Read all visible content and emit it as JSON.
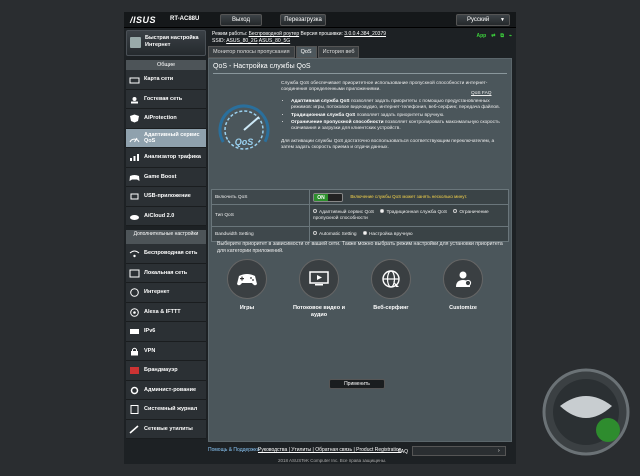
{
  "header": {
    "logo": "/ISUS",
    "model": "RT-AC88U",
    "logout": "Выход",
    "reboot": "Перезагрузка",
    "language": "Русский"
  },
  "info": {
    "mode_label": "Режим работы:",
    "mode_value": "Беспроводной роутер",
    "fw_label": "Версия прошивки:",
    "fw_value": "3.0.0.4.384_20379",
    "ssid_label": "SSID:",
    "ssid1": "ASUS_80_2G",
    "ssid2": "ASUS_80_5G",
    "app_label": "App"
  },
  "sidebar": {
    "qis": "Быстрая настройка Интернет",
    "general_header": "Общие",
    "general": [
      {
        "label": "Карта сети",
        "icon": "network-map-icon"
      },
      {
        "label": "Гостевая сеть",
        "icon": "guest-network-icon"
      },
      {
        "label": "AiProtection",
        "icon": "shield-icon"
      },
      {
        "label": "Адаптивный сервис QoS",
        "icon": "qos-icon",
        "active": true
      },
      {
        "label": "Анализатор трафика",
        "icon": "traffic-analyzer-icon"
      },
      {
        "label": "Game Boost",
        "icon": "gamepad-icon"
      },
      {
        "label": "USB-приложение",
        "icon": "usb-icon"
      },
      {
        "label": "AiCloud 2.0",
        "icon": "cloud-icon"
      }
    ],
    "advanced_header": "Дополнительные настройки",
    "advanced": [
      {
        "label": "Беспроводная сеть",
        "icon": "wireless-icon"
      },
      {
        "label": "Локальная сеть",
        "icon": "lan-icon"
      },
      {
        "label": "Интернет",
        "icon": "globe-icon"
      },
      {
        "label": "Alexa & IFTTT",
        "icon": "alexa-icon"
      },
      {
        "label": "IPv6",
        "icon": "ipv6-icon"
      },
      {
        "label": "VPN",
        "icon": "vpn-icon"
      },
      {
        "label": "Брандмауэр",
        "icon": "firewall-icon"
      },
      {
        "label": "Админист-рование",
        "icon": "admin-icon"
      },
      {
        "label": "Системный журнал",
        "icon": "syslog-icon"
      },
      {
        "label": "Сетевые утилиты",
        "icon": "tools-icon"
      }
    ]
  },
  "tabs": [
    "Монитор полосы пропускания",
    "QoS",
    "История веб"
  ],
  "qos": {
    "title": "QoS - Настройка службы QoS",
    "intro": "Служба QoS обеспечивает приоритетное использование пропускной способности интернет-соединения определенными приложениями.",
    "bullets": [
      {
        "bold": "Адаптивная служба QoS",
        "text": " позволяет задать приоритеты с помощью предустановленных режимов: игры, потоковое видеоаудио, интернет-телефония, веб-серфинг, передача файлов."
      },
      {
        "bold": "Традиционная служба QoS",
        "text": " позволяет задать приоритеты вручную."
      },
      {
        "bold": "Ограничение пропускной способности",
        "text": " позволяет контролировать максимальную скорость скачивания и загрузки для клиентских устройств."
      }
    ],
    "enable_note": "Для активации службы QoS достаточно воспользоваться соответствующим переключателем, а затем задать скорость приема и отдачи данных.",
    "faq_link": "QoS FAQ",
    "speedo_text": "QoS"
  },
  "settings": {
    "enable_label": "Включить QoS",
    "toggle_on": "ON",
    "warning": "Включение службы QoS может занять несколько минут.",
    "type_label": "Тип QoS",
    "type_options": [
      "Адаптивный сервис QoS",
      "Традиционная служба QoS",
      "Ограничение пропускной способности"
    ],
    "type_selected": 1,
    "bw_label": "Bandwidth Setting",
    "bw_options": [
      "Automatic Setting",
      "Настройка вручную"
    ],
    "bw_selected": 1
  },
  "priority": {
    "text": "Выберите приоритет в зависимости от вашей сети. Также можно выбрать режим настройки для установки приоритета для категории приложений.",
    "cards": [
      {
        "label": "Игры",
        "icon": "gamepad-icon"
      },
      {
        "label": "Потоковое видео и аудио",
        "icon": "media-streaming-icon"
      },
      {
        "label": "Веб-серфинг",
        "icon": "web-surfing-icon"
      },
      {
        "label": "Customize",
        "icon": "customize-icon"
      }
    ]
  },
  "apply_label": "Применить",
  "footer": {
    "help": "Помощь & Поддержка",
    "links": "Руководства | Утилиты | Обратная связь | Product Registration",
    "faq": "FAQ",
    "copyright": "2018 ASUSTeK Computer Inc. Все права защищены."
  },
  "colors": {
    "accent": "#2c8f2c",
    "active_nav": "#8fa1ad",
    "warning": "#f5d34a"
  }
}
